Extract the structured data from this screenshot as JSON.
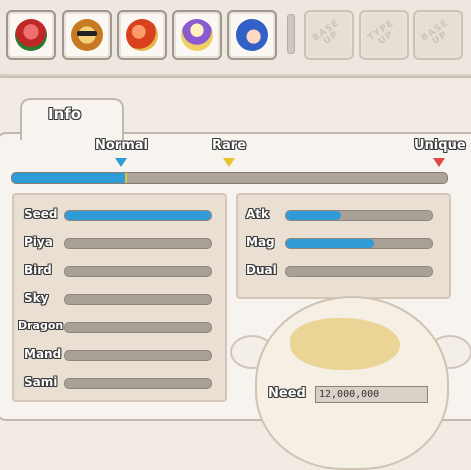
{
  "toolbar": {
    "slots": [
      {
        "icon": "red-bird-pet-icon",
        "color": "#d83a3a"
      },
      {
        "icon": "sunglasses-lion-pet-icon",
        "color": "#e0a030"
      },
      {
        "icon": "red-fruit-pet-icon",
        "color": "#e05a2a"
      },
      {
        "icon": "bunny-mage-pet-icon",
        "color": "#f0d060"
      },
      {
        "icon": "blue-hair-character-icon",
        "color": "#3060c8"
      }
    ],
    "locked_slots": [
      {
        "label": "BASE UP"
      },
      {
        "label": "TYPE UP"
      },
      {
        "label": "BASE UP"
      }
    ]
  },
  "tab": {
    "label": "Info"
  },
  "rarity": {
    "levels": [
      {
        "label": "Normal",
        "marker_color": "#2f9bd7"
      },
      {
        "label": "Rare",
        "marker_color": "#e8c32d"
      },
      {
        "label": "Unique",
        "marker_color": "#e0464a"
      }
    ],
    "progress_fraction": 0.26
  },
  "left_stats": [
    {
      "label": "Seed",
      "value": 1.0
    },
    {
      "label": "Piya",
      "value": 0
    },
    {
      "label": "Bird",
      "value": 0
    },
    {
      "label": "Sky",
      "value": 0
    },
    {
      "label": "Dragon",
      "value": 0
    },
    {
      "label": "Mand",
      "value": 0
    },
    {
      "label": "Sami",
      "value": 0
    }
  ],
  "right_stats": [
    {
      "label": "Atk",
      "value": 0.38
    },
    {
      "label": "Mag",
      "value": 0.6
    },
    {
      "label": "Dual",
      "value": 0
    }
  ],
  "need": {
    "label": "Need",
    "value": "12,000,000"
  },
  "colors": {
    "fill": "#2f9bd7",
    "track": "#a89f95",
    "panel": "#f7f3ee"
  }
}
